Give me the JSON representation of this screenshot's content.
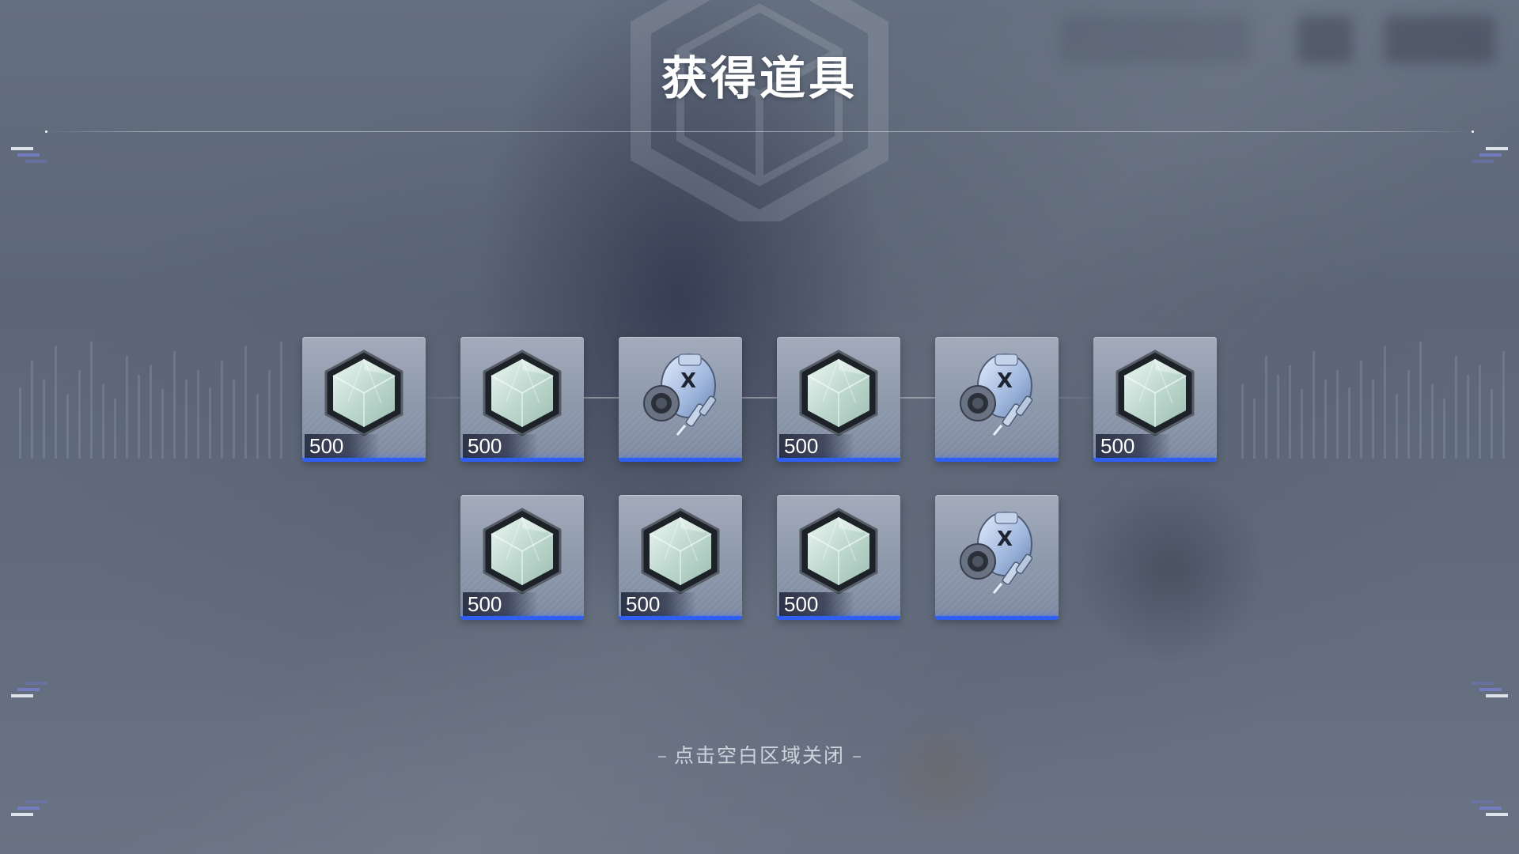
{
  "header": {
    "title": "获得道具"
  },
  "items": [
    {
      "type": "crystal",
      "quantity": "500",
      "icon": "hex-crystal-icon"
    },
    {
      "type": "crystal",
      "quantity": "500",
      "icon": "hex-crystal-icon"
    },
    {
      "type": "module",
      "quantity": "",
      "icon": "canister-module-icon"
    },
    {
      "type": "crystal",
      "quantity": "500",
      "icon": "hex-crystal-icon"
    },
    {
      "type": "module",
      "quantity": "",
      "icon": "canister-module-icon"
    },
    {
      "type": "crystal",
      "quantity": "500",
      "icon": "hex-crystal-icon"
    },
    {
      "type": "crystal",
      "quantity": "500",
      "icon": "hex-crystal-icon"
    },
    {
      "type": "crystal",
      "quantity": "500",
      "icon": "hex-crystal-icon"
    },
    {
      "type": "crystal",
      "quantity": "500",
      "icon": "hex-crystal-icon"
    },
    {
      "type": "module",
      "quantity": "",
      "icon": "canister-module-icon"
    }
  ],
  "footer": {
    "close_hint": "点击空白区域关闭"
  },
  "colors": {
    "rarity_blue": "#2f5ff2",
    "card_top": "#a3acbb",
    "title_text": "#ffffff"
  }
}
